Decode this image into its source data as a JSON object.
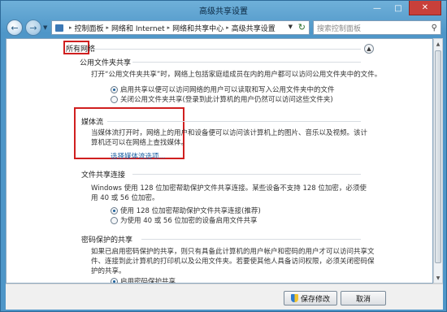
{
  "window": {
    "title": "高级共享设置"
  },
  "nav": {
    "breadcrumb": [
      "控制面板",
      "网络和 Internet",
      "网络和共享中心",
      "高级共享设置"
    ],
    "search_placeholder": "搜索控制面板"
  },
  "network_header": "所有网络",
  "public_folder": {
    "title": "公用文件夹共享",
    "desc": "打开“公用文件夹共享”时，网络上包括家庭组成员在内的用户都可以访问公用文件夹中的文件。",
    "options": [
      {
        "label": "启用共享以便可以访问网络的用户可以读取和写入公用文件夹中的文件",
        "selected": true
      },
      {
        "label": "关闭公用文件夹共享(登录到此计算机的用户仍然可以访问这些文件夹)",
        "selected": false
      }
    ]
  },
  "media": {
    "title": "媒体流",
    "desc": "当媒体流打开时，网络上的用户和设备便可以访问该计算机上的图片、音乐以及视频。该计算机还可以在网络上查找媒体。",
    "link": "选择媒体流选项..."
  },
  "file_sharing": {
    "title": "文件共享连接",
    "desc": "Windows 使用 128 位加密帮助保护文件共享连接。某些设备不支持 128 位加密，必须使用 40 或 56 位加密。",
    "options": [
      {
        "label": "使用 128 位加密帮助保护文件共享连接(推荐)",
        "selected": true
      },
      {
        "label": "为使用 40 或 56 位加密的设备启用文件共享",
        "selected": false
      }
    ]
  },
  "password": {
    "title": "密码保护的共享",
    "desc": "如果已启用密码保护的共享，则只有具备此计算机的用户帐户和密码的用户才可以访问共享文件、连接到此计算机的打印机以及公用文件夹。若要使其他人具备访问权限，必须关闭密码保护的共享。",
    "options": [
      {
        "label": "启用密码保护共享",
        "selected": true
      }
    ]
  },
  "footer": {
    "save_label": "保存修改",
    "cancel_label": "取消"
  }
}
